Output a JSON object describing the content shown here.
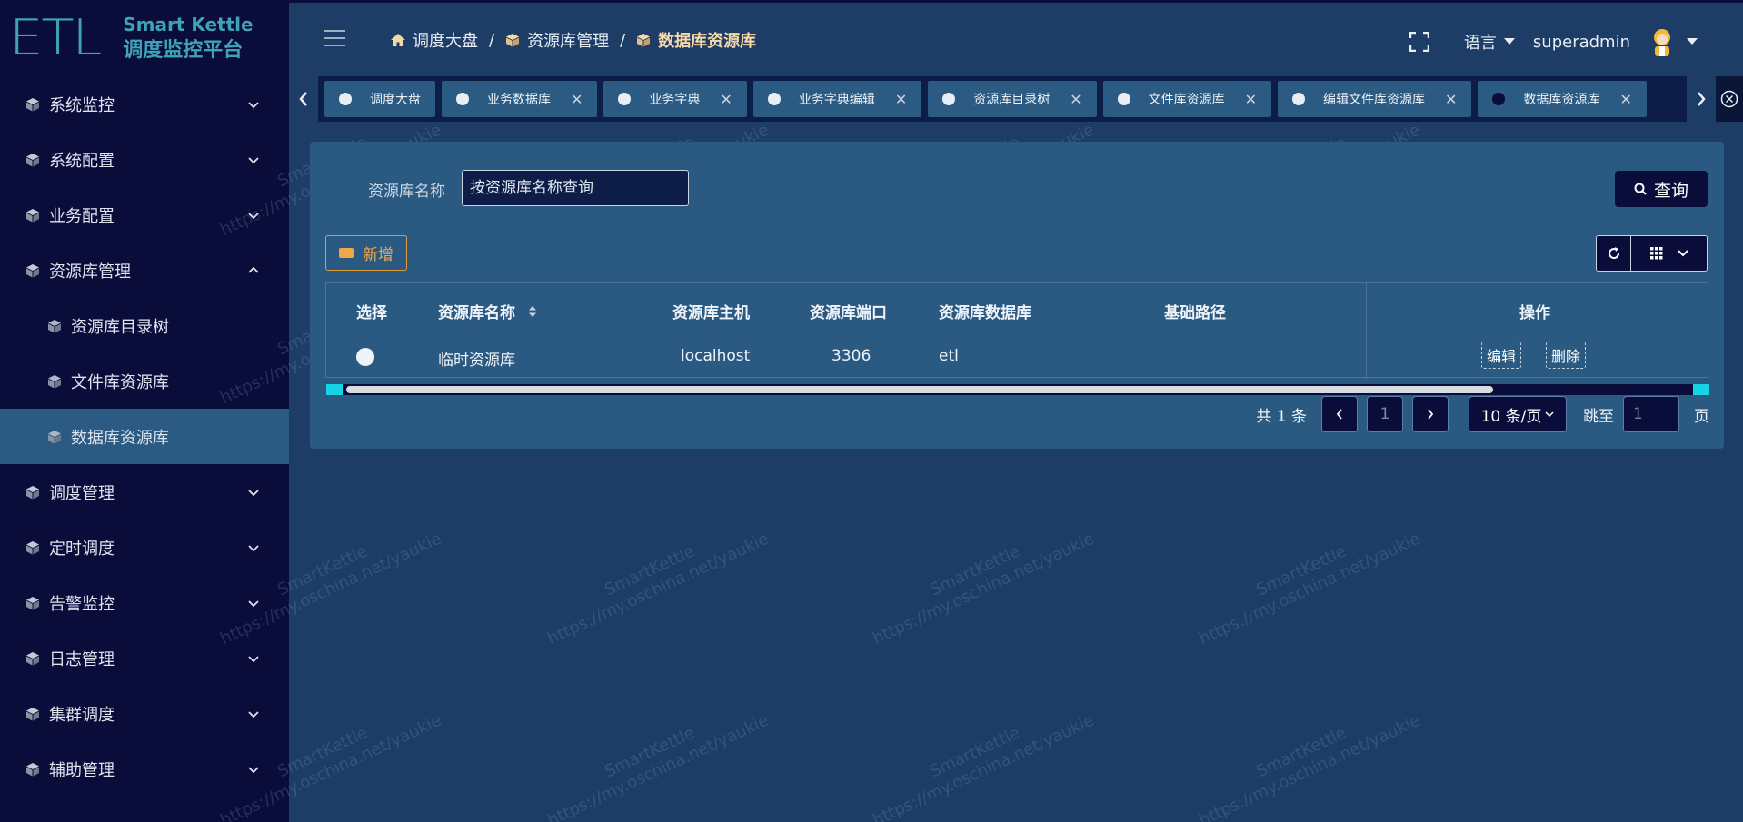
{
  "logo": {
    "mark": "ETL",
    "title": "Smart Kettle",
    "subtitle": "调度监控平台"
  },
  "sidebar": {
    "items": [
      {
        "label": "系统监控",
        "expanded": false
      },
      {
        "label": "系统配置",
        "expanded": false
      },
      {
        "label": "业务配置",
        "expanded": false
      },
      {
        "label": "资源库管理",
        "expanded": true
      },
      {
        "label": "资源库目录树",
        "sub": true
      },
      {
        "label": "文件库资源库",
        "sub": true
      },
      {
        "label": "数据库资源库",
        "sub": true,
        "active": true
      },
      {
        "label": "调度管理",
        "expanded": false
      },
      {
        "label": "定时调度",
        "expanded": false
      },
      {
        "label": "告警监控",
        "expanded": false
      },
      {
        "label": "日志管理",
        "expanded": false
      },
      {
        "label": "集群调度",
        "expanded": false
      },
      {
        "label": "辅助管理",
        "expanded": false
      }
    ]
  },
  "breadcrumb": {
    "home": "调度大盘",
    "parent": "资源库管理",
    "current": "数据库资源库"
  },
  "header": {
    "language": "语言",
    "user": "superadmin"
  },
  "tabs": [
    {
      "label": "调度大盘",
      "closable": false
    },
    {
      "label": "业务数据库",
      "closable": true
    },
    {
      "label": "业务字典",
      "closable": true
    },
    {
      "label": "业务字典编辑",
      "closable": true
    },
    {
      "label": "资源库目录树",
      "closable": true
    },
    {
      "label": "文件库资源库",
      "closable": true
    },
    {
      "label": "编辑文件库资源库",
      "closable": true
    },
    {
      "label": "数据库资源库",
      "closable": true,
      "current": true
    }
  ],
  "tab_close_glyph": "✕",
  "search": {
    "label": "资源库名称",
    "placeholder": "按资源库名称查询",
    "button": "查询"
  },
  "toolbar": {
    "add": "新增"
  },
  "table": {
    "headers": {
      "select": "选择",
      "name": "资源库名称",
      "host": "资源库主机",
      "port": "资源库端口",
      "db": "资源库数据库",
      "path": "基础路径",
      "ops": "操作"
    },
    "rows": [
      {
        "name": "临时资源库",
        "host": "localhost",
        "port": "3306",
        "db": "etl",
        "path": "",
        "edit": "编辑",
        "delete": "删除"
      }
    ]
  },
  "pager": {
    "total": "共 1 条",
    "page": "1",
    "size": "10 条/页",
    "jump_label": "跳至",
    "jump_value": "1",
    "page_unit": "页"
  },
  "watermark": {
    "line1": "SmartKettle",
    "line2": "https://my.oschina.net/yaukie"
  },
  "colors": {
    "sidebar": "#0a0c3a",
    "main": "#1d3d66",
    "card": "#2a5a82",
    "accent": "#f0a64a",
    "breadcrumb_current": "#f6d8a8"
  }
}
